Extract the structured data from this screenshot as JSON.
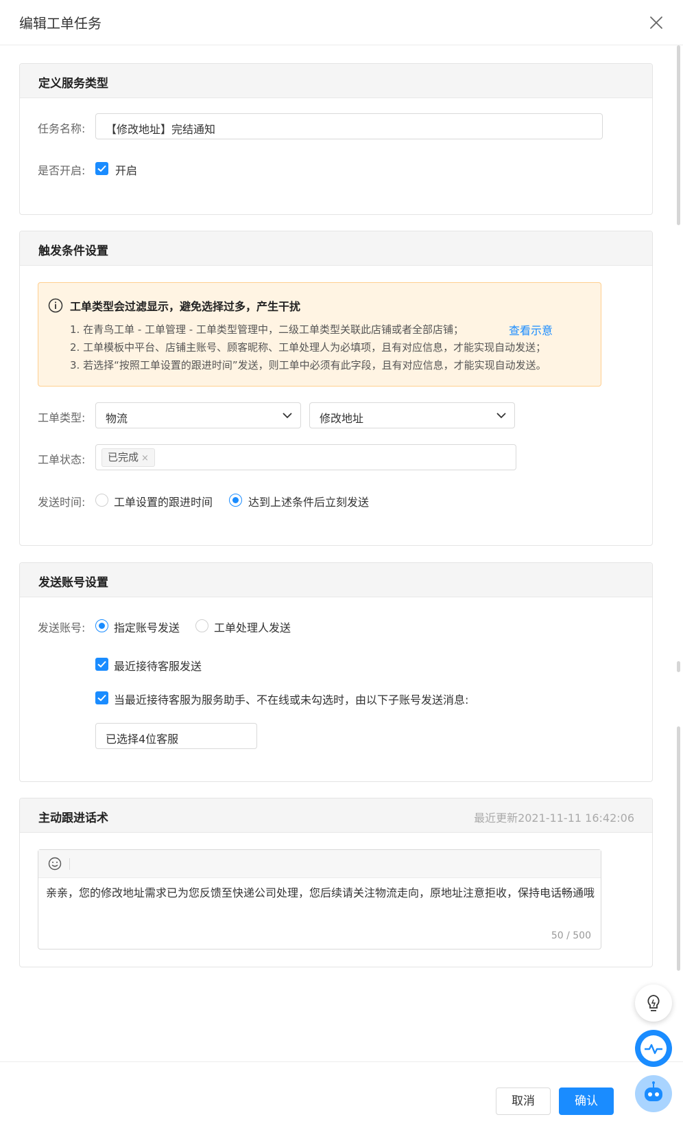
{
  "dialog": {
    "title": "编辑工单任务",
    "close_icon": "close-icon"
  },
  "section_service": {
    "title": "定义服务类型",
    "task_name_label": "任务名称:",
    "task_name_value": "【修改地址】完结通知",
    "enabled_label": "是否开启:",
    "enabled_option": "开启",
    "enabled_checked": true
  },
  "section_trigger": {
    "title": "触发条件设置",
    "notice": {
      "title": "工单类型会过滤显示，避免选择过多，产生干扰",
      "lines": [
        "1. 在青鸟工单 - 工单管理 - 工单类型管理中，二级工单类型关联此店铺或者全部店铺；",
        "2. 工单模板中平台、店铺主账号、顾客昵称、工单处理人为必填项，且有对应信息，才能实现自动发送；",
        "3. 若选择“按照工单设置的跟进时间”发送，则工单中必须有此字段，且有对应信息，才能实现自动发送。"
      ],
      "link": "查看示意"
    },
    "type_label": "工单类型:",
    "type_level1": "物流",
    "type_level2": "修改地址",
    "status_label": "工单状态:",
    "status_tags": [
      "已完成"
    ],
    "send_time_label": "发送时间:",
    "send_time_options": [
      "工单设置的跟进时间",
      "达到上述条件后立刻发送"
    ],
    "send_time_selected": 1
  },
  "section_account": {
    "title": "发送账号设置",
    "account_label": "发送账号:",
    "account_options": [
      "指定账号发送",
      "工单处理人发送"
    ],
    "account_selected": 0,
    "check_recent": "最近接待客服发送",
    "check_fallback": "当最近接待客服为服务助手、不在线或未勾选时，由以下子账号发送消息:",
    "selected_agents": "已选择4位客服"
  },
  "section_script": {
    "title": "主动跟进话术",
    "updated": "最近更新2021-11-11 16:42:06",
    "content": "亲亲，您的修改地址需求已为您反馈至快递公司处理，您后续请关注物流走向，原地址注意拒收，保持电话畅通哦",
    "counter": "50 / 500"
  },
  "footer": {
    "cancel": "取消",
    "confirm": "确认"
  },
  "floating": [
    "lightbulb-icon",
    "heartbeat-icon",
    "robot-icon"
  ],
  "colors": {
    "accent": "#1a8cff",
    "notice_bg": "#fff4e3",
    "notice_border": "#ffcf8f"
  }
}
